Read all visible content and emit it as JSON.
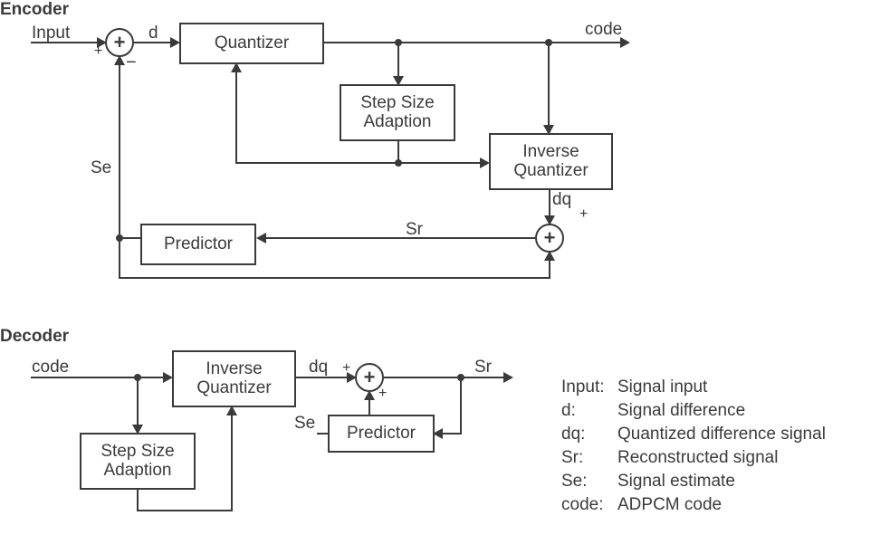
{
  "encoder": {
    "title": "Encoder",
    "input": "Input",
    "d": "d",
    "code": "code",
    "Se": "Se",
    "dq": "dq",
    "plus_dq": "+",
    "Sr": "Sr",
    "sum_in_plus": "+",
    "sum_in_minus": "−",
    "sum_in_glyph": "+",
    "sum_r_glyph": "+",
    "boxes": {
      "quantizer": "Quantizer",
      "step": "Step Size\nAdaption",
      "invq": "Inverse\nQuantizer",
      "predictor": "Predictor"
    }
  },
  "decoder": {
    "title": "Decoder",
    "code": "code",
    "dq": "dq",
    "Sr": "Sr",
    "Se": "Se",
    "plus_a": "+",
    "plus_b": "+",
    "sum_glyph": "+",
    "boxes": {
      "invq": "Inverse\nQuantizer",
      "step": "Step Size\nAdaption",
      "predictor": "Predictor"
    }
  },
  "legend": {
    "rows": [
      {
        "k": "Input:",
        "v": "Signal input"
      },
      {
        "k": "d:",
        "v": "Signal difference"
      },
      {
        "k": "dq:",
        "v": "Quantized difference signal"
      },
      {
        "k": "Sr:",
        "v": "Reconstructed signal"
      },
      {
        "k": "Se:",
        "v": "Signal estimate"
      },
      {
        "k": "code:",
        "v": "ADPCM code"
      }
    ]
  },
  "chart_data": {
    "type": "diagram",
    "blocks": [
      {
        "diagram": "encoder",
        "id": "enc_sum_diff",
        "kind": "sum",
        "inputs": [
          "Input(+)",
          "Se(-)"
        ],
        "output": "d"
      },
      {
        "diagram": "encoder",
        "id": "enc_quant",
        "kind": "block",
        "label": "Quantizer",
        "inputs": [
          "d",
          "step_size"
        ],
        "output": "code"
      },
      {
        "diagram": "encoder",
        "id": "enc_step",
        "kind": "block",
        "label": "Step Size Adaption",
        "inputs": [
          "code"
        ],
        "outputs": [
          "→Quantizer",
          "→Inverse Quantizer"
        ]
      },
      {
        "diagram": "encoder",
        "id": "enc_invq",
        "kind": "block",
        "label": "Inverse Quantizer",
        "inputs": [
          "code",
          "step_size"
        ],
        "output": "dq"
      },
      {
        "diagram": "encoder",
        "id": "enc_sum_recon",
        "kind": "sum",
        "inputs": [
          "dq(+)",
          "Se(+)"
        ],
        "output": "Sr"
      },
      {
        "diagram": "encoder",
        "id": "enc_pred",
        "kind": "block",
        "label": "Predictor",
        "inputs": [
          "Sr"
        ],
        "output": "Se"
      },
      {
        "diagram": "decoder",
        "id": "dec_invq",
        "kind": "block",
        "label": "Inverse Quantizer",
        "inputs": [
          "code",
          "step_size"
        ],
        "output": "dq"
      },
      {
        "diagram": "decoder",
        "id": "dec_step",
        "kind": "block",
        "label": "Step Size Adaption",
        "inputs": [
          "code"
        ],
        "output": "→Inverse Quantizer"
      },
      {
        "diagram": "decoder",
        "id": "dec_sum",
        "kind": "sum",
        "inputs": [
          "dq(+)",
          "Se(+)"
        ],
        "output": "Sr"
      },
      {
        "diagram": "decoder",
        "id": "dec_pred",
        "kind": "block",
        "label": "Predictor",
        "inputs": [
          "Sr"
        ],
        "output": "Se"
      }
    ],
    "signals": {
      "Input": "Signal input",
      "d": "Signal difference",
      "dq": "Quantized difference signal",
      "Sr": "Reconstructed signal",
      "Se": "Signal estimate",
      "code": "ADPCM code"
    }
  }
}
